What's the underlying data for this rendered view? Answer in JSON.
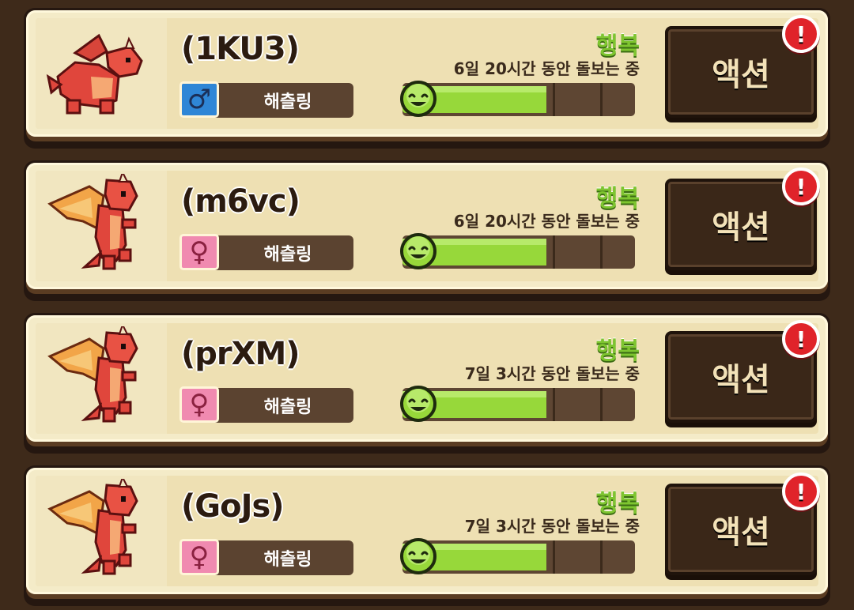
{
  "pets": [
    {
      "name": "(1KU3)",
      "gender": "male",
      "gender_symbol": "♂",
      "stage": "해츨링",
      "mood": "행복",
      "care_time": "6일 20시간 동안 돌보는 중",
      "happiness": 0.62,
      "action_label": "액션",
      "alert": "!",
      "pose": "crouch"
    },
    {
      "name": "(m6vc)",
      "gender": "female",
      "gender_symbol": "♀",
      "stage": "해츨링",
      "mood": "행복",
      "care_time": "6일 20시간 동안 돌보는 중",
      "happiness": 0.62,
      "action_label": "액션",
      "alert": "!",
      "pose": "stand"
    },
    {
      "name": "(prXM)",
      "gender": "female",
      "gender_symbol": "♀",
      "stage": "해츨링",
      "mood": "행복",
      "care_time": "7일 3시간 동안 돌보는 중",
      "happiness": 0.62,
      "action_label": "액션",
      "alert": "!",
      "pose": "stand"
    },
    {
      "name": "(GoJs)",
      "gender": "female",
      "gender_symbol": "♀",
      "stage": "해츨링",
      "mood": "행복",
      "care_time": "7일 3시간 동안 돌보는 중",
      "happiness": 0.62,
      "action_label": "액션",
      "alert": "!",
      "pose": "stand"
    }
  ],
  "colors": {
    "background": "#3e2a1a",
    "card": "#f4ebc8",
    "happy_green": "#97d83a",
    "mood_text": "#7ec530",
    "alert_red": "#e0232a",
    "male_blue": "#2f86d6",
    "female_pink": "#f08ab0"
  }
}
